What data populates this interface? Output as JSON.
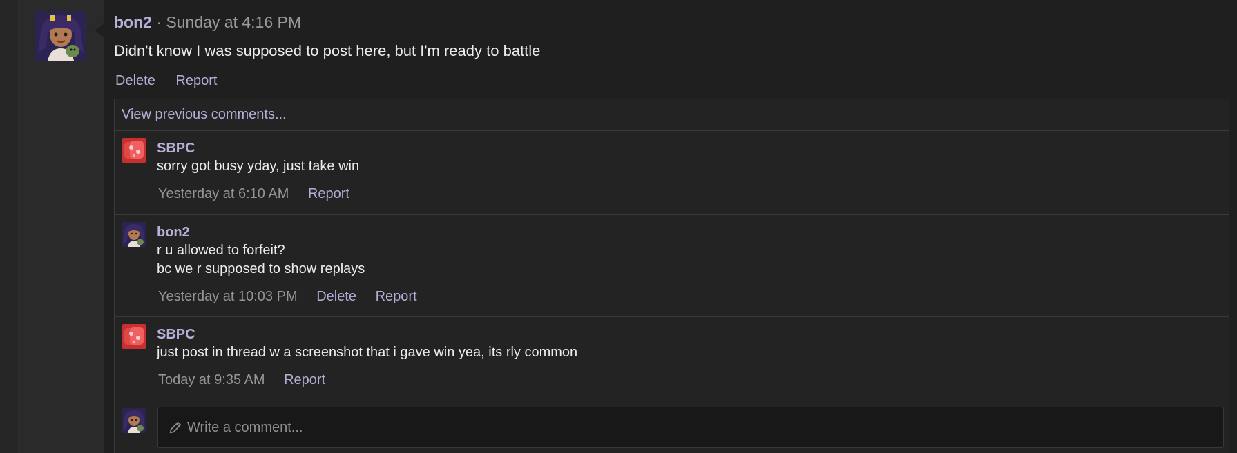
{
  "post": {
    "username": "bon2",
    "separator": "·",
    "time": "Sunday at 4:16 PM",
    "message": "Didn't know I was supposed to post here, but I'm ready to battle",
    "actions": {
      "delete": "Delete",
      "report": "Report"
    }
  },
  "comments": {
    "view_previous": "View previous comments...",
    "items": [
      {
        "username": "SBPC",
        "lines": [
          "sorry got busy yday, just take win"
        ],
        "time": "Yesterday at 6:10 AM",
        "report": "Report"
      },
      {
        "username": "bon2",
        "lines": [
          "r u allowed to forfeit?",
          "bc we r supposed to show replays"
        ],
        "time": "Yesterday at 10:03 PM",
        "delete": "Delete",
        "report": "Report"
      },
      {
        "username": "SBPC",
        "lines": [
          "just post in thread w a screenshot that i gave win yea, its rly common"
        ],
        "time": "Today at 9:35 AM",
        "report": "Report"
      }
    ],
    "write_placeholder": "Write a comment..."
  },
  "icons": {
    "pencil": "pencil-icon",
    "avatar_bon2": "avatar-bon2",
    "avatar_sbpc": "avatar-sbpc"
  },
  "colors": {
    "background": "#1f1f1f",
    "username": "#b9afd9",
    "link": "#b4aed6",
    "muted": "#959595"
  }
}
